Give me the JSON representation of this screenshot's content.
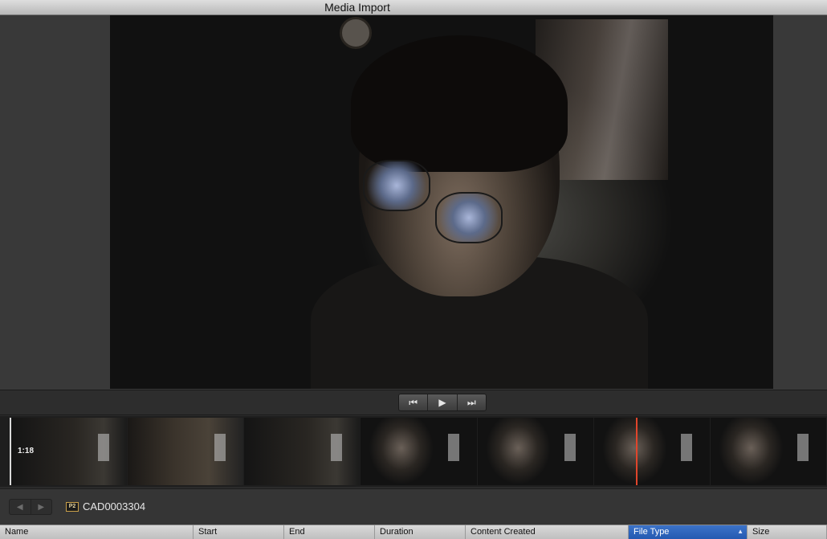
{
  "window": {
    "title": "Media Import"
  },
  "transport": {
    "prev_icon": "skip-back-icon",
    "play_icon": "play-icon",
    "next_icon": "skip-forward-icon",
    "prev_glyph": "⏮",
    "play_glyph": "▶",
    "next_glyph": "⏭"
  },
  "filmstrip": {
    "duration_label": "1:18",
    "frame_count": 7,
    "playhead_color": "#e0452b"
  },
  "clip": {
    "name": "CAD0003304",
    "format_badge": "P2",
    "nav_back_glyph": "◀",
    "nav_forward_glyph": "▶"
  },
  "table": {
    "columns": [
      {
        "label": "Name"
      },
      {
        "label": "Start"
      },
      {
        "label": "End"
      },
      {
        "label": "Duration"
      },
      {
        "label": "Content Created"
      },
      {
        "label": "File Type",
        "sorted": true,
        "sort_glyph": "▲"
      },
      {
        "label": "Size"
      }
    ]
  },
  "colors": {
    "accent": "#2459b1",
    "background": "#2b2b2b"
  }
}
